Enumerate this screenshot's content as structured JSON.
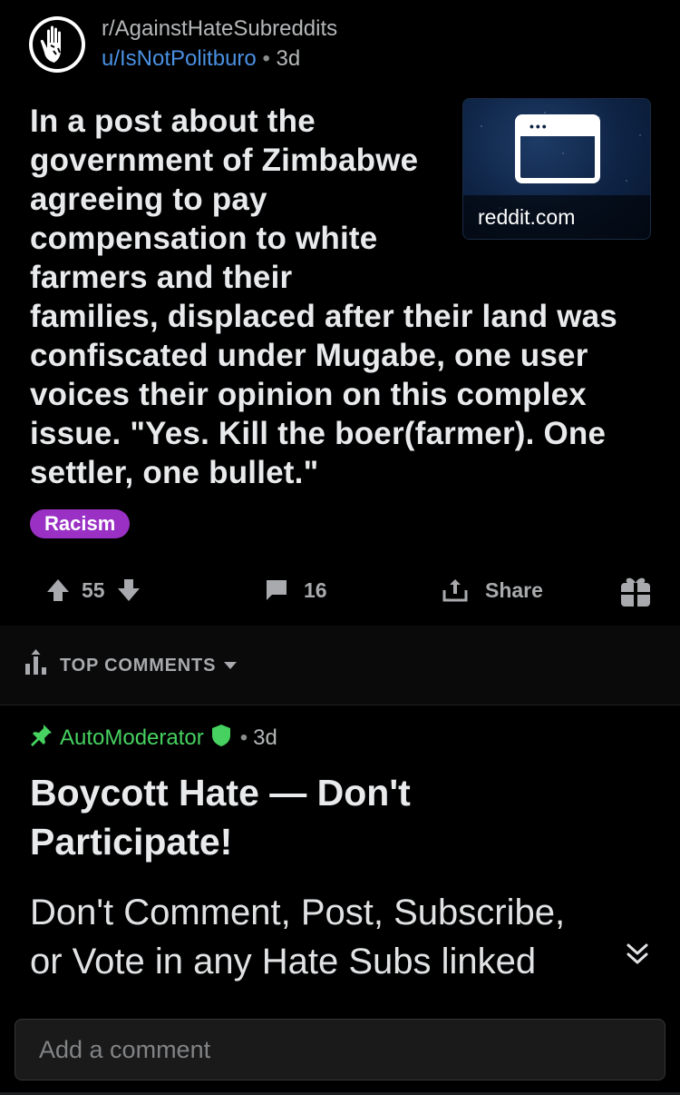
{
  "post": {
    "subreddit": "r/AgainstHateSubreddits",
    "author": "u/IsNotPolitburo",
    "separator": "•",
    "age": "3d",
    "title_lines": [
      "In a post about the",
      "government of Zimbabwe",
      "agreeing to pay",
      "compensation to white",
      "farmers and their",
      "families, displaced after their land was",
      "confiscated under Mugabe, one user",
      "voices their opinion on this complex",
      "issue. \"Yes. Kill the boer(farmer). One",
      "settler, one bullet.\""
    ],
    "link_domain": "reddit.com",
    "flair": "Racism",
    "flair_color": "#9a31c4"
  },
  "actions": {
    "score": "55",
    "comments": "16",
    "share_label": "Share"
  },
  "sort": {
    "label": "TOP COMMENTS"
  },
  "comment": {
    "author": "AutoModerator",
    "separator": "•",
    "age": "3d",
    "title_lines": [
      "Boycott Hate — Don't",
      "Participate!"
    ],
    "body_lines": [
      "Don't Comment, Post, Subscribe,",
      "or Vote in any Hate Subs linked"
    ],
    "author_color": "#46d160"
  },
  "composer": {
    "placeholder": "Add a comment"
  },
  "colors": {
    "accent_blue": "#4a90e2",
    "background": "#000000"
  }
}
